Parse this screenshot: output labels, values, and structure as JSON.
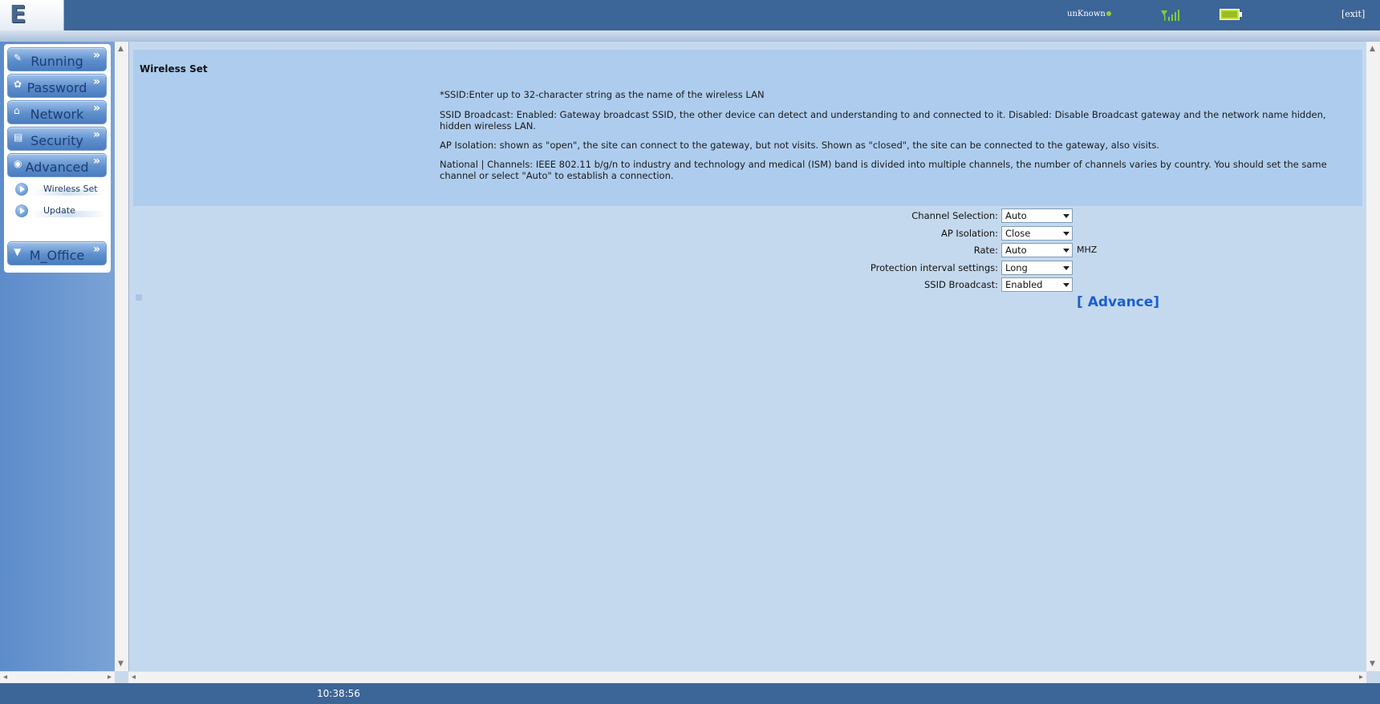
{
  "header": {
    "logo": "E 6",
    "status": "unKnown",
    "exit_label": "[exit]"
  },
  "sidebar": {
    "menu": [
      {
        "label": "Running",
        "icon": "running-icon"
      },
      {
        "label": "Password",
        "icon": "password-icon"
      },
      {
        "label": "Network",
        "icon": "network-icon"
      },
      {
        "label": "Security",
        "icon": "security-icon"
      },
      {
        "label": "Advanced",
        "icon": "advanced-icon"
      },
      {
        "label": "M_Office",
        "icon": "office-icon"
      }
    ],
    "submenu": [
      {
        "label": "Wireless Set"
      },
      {
        "label": "Update"
      }
    ]
  },
  "main": {
    "title": "Wireless Set",
    "help": [
      "*SSID:Enter up to 32-character string as the name of the wireless LAN",
      "SSID Broadcast: Enabled: Gateway broadcast SSID, the other device can detect and understanding to and connected to it. Disabled: Disable Broadcast gateway and the network name hidden, hidden wireless LAN.",
      "AP Isolation: shown as \"open\", the site can connect to the gateway, but not visits. Shown as \"closed\", the site can be connected to the gateway, also visits.",
      "National | Channels: IEEE 802.11 b/g/n to industry and technology and medical (ISM) band is divided into multiple channels, the number of channels varies by country. You should set the same channel or select \"Auto\" to establish a connection."
    ],
    "form": {
      "channel_label": "Channel Selection:",
      "channel_value": "Auto",
      "isolation_label": "AP Isolation:",
      "isolation_value": "Close",
      "rate_label": "Rate:",
      "rate_value": "Auto",
      "rate_unit": "MHZ",
      "protection_label": "Protection interval settings:",
      "protection_value": "Long",
      "ssid_label": "SSID Broadcast:",
      "ssid_value": "Enabled"
    },
    "advance_link": "[ Advance]"
  },
  "footer": {
    "time": "10:38:56"
  },
  "colors": {
    "header_bg": "#3c6598",
    "content_bg": "#c5d9ee",
    "info_bg": "#aecdee",
    "link": "#1a5fd0"
  }
}
